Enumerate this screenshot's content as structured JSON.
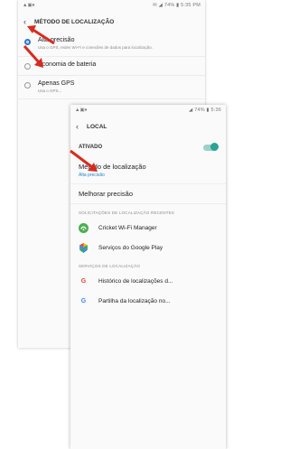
{
  "back_screen": {
    "status_left": "▲▣♦",
    "status_right": "✉ ◢ 74% ▮ 5:35 PM",
    "title": "MÉTODO DE LOCALIZAÇÃO",
    "options": [
      {
        "label": "Alta precisão",
        "desc": "Usa o GPS, redes Wi-Fi e conexões de dados para localização.",
        "selected": true
      },
      {
        "label": "Economia de bateria",
        "desc": "",
        "selected": false
      },
      {
        "label": "Apenas GPS",
        "desc": "Usa o GPS...",
        "selected": false
      }
    ]
  },
  "front_screen": {
    "status_left": "▲▣♦",
    "status_right": "◢ 74% ▮ 5:36",
    "title": "LOCAL",
    "toggle": {
      "label": "ATIVADO",
      "state": "on"
    },
    "menu": [
      {
        "label": "Método de localização",
        "sub": "Alta precisão"
      },
      {
        "label": "Melhorar precisão",
        "sub": ""
      }
    ],
    "recent_section": "SOLICITAÇÕES DE LOCALIZAÇÃO RECENTES",
    "recent_apps": [
      {
        "label": "Cricket Wi-Fi Manager",
        "icon": "cricket-wifi-icon",
        "color": "#4caf50"
      },
      {
        "label": "Serviços do Google Play",
        "icon": "google-play-services-icon",
        "color": "#ff9800"
      }
    ],
    "services_section": "SERVIÇOS DE LOCALIZAÇÃO",
    "services": [
      {
        "label": "Histórico de localizações d...",
        "icon": "google-icon"
      },
      {
        "label": "Partilha da localização no...",
        "icon": "google-icon"
      }
    ]
  },
  "colors": {
    "arrow": "#d62b1f",
    "accent": "#2d77d3",
    "switch": "#2aa495"
  }
}
